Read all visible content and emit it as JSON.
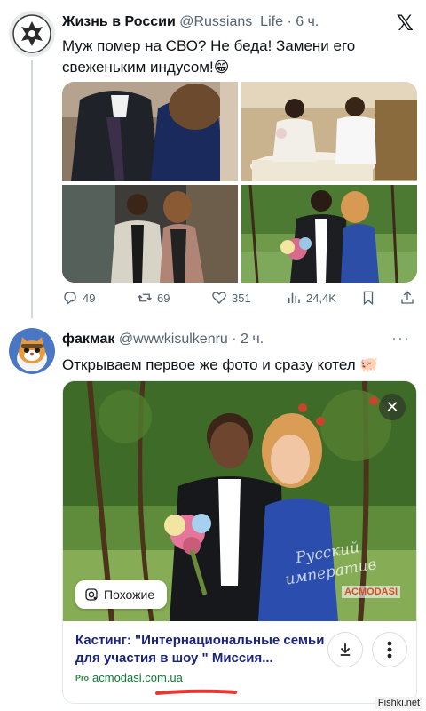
{
  "tweet1": {
    "display_name": "Жизнь в России",
    "handle": "@Russians_Life",
    "time": "· 6 ч.",
    "text": "Муж помер на СВО? Не беда! Замени его свеженьким индусом!😁",
    "stats": {
      "replies": "49",
      "retweets": "69",
      "likes": "351",
      "views": "24,4K"
    }
  },
  "tweet2": {
    "display_name": "факмак",
    "handle": "@wwwkisulkenru",
    "time": "· 2 ч.",
    "text": "Открываем первое же фото и сразу котел 🐖"
  },
  "lens_card": {
    "similar_label": "Похожие",
    "watermark_line1": "Русский",
    "watermark_line2": "императив",
    "watermark_logo": "ACMODASI",
    "title": "Кастинг: \"Интернациональные семьи для участия в шоу \" Миссия...",
    "source_favicon": "Pro",
    "source": "acmodasi.com.ua",
    "close_glyph": "✕"
  },
  "site_badge": "Fishki.net",
  "colors": {
    "underline": "#e53935",
    "source_green": "#0b7a35",
    "title_blue": "#1a237e"
  }
}
